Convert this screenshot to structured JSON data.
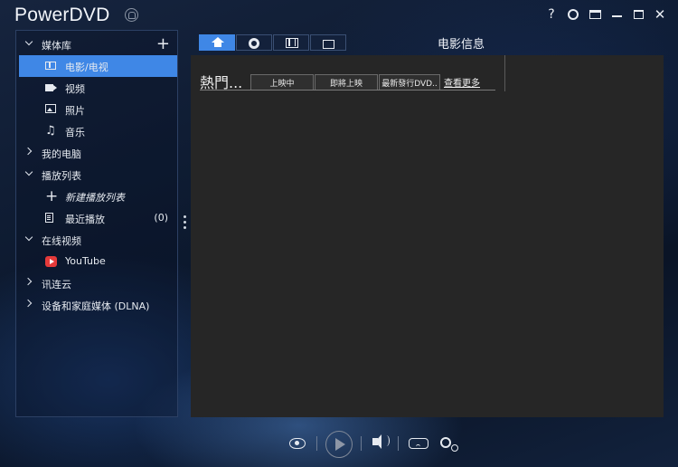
{
  "app": {
    "title": "PowerDVD"
  },
  "window": {
    "help_label": "?",
    "close_label": "✕"
  },
  "sidebar": {
    "items": [
      {
        "label": "媒体库",
        "type": "section",
        "expanded": true,
        "action": "+"
      },
      {
        "label": "电影/电视",
        "type": "sub",
        "icon": "film-icon",
        "selected": true
      },
      {
        "label": "视频",
        "type": "sub",
        "icon": "video-camera-icon"
      },
      {
        "label": "照片",
        "type": "sub",
        "icon": "photo-icon"
      },
      {
        "label": "音乐",
        "type": "sub",
        "icon": "music-icon"
      },
      {
        "label": "我的电脑",
        "type": "section",
        "expanded": false
      },
      {
        "label": "播放列表",
        "type": "section",
        "expanded": true
      },
      {
        "label": "新建播放列表",
        "type": "sub",
        "icon": "plus-icon",
        "italic": true
      },
      {
        "label": "最近播放",
        "type": "sub",
        "icon": "recent-icon",
        "count": "(0)"
      },
      {
        "label": "在线视频",
        "type": "section",
        "expanded": true
      },
      {
        "label": "YouTube",
        "type": "sub",
        "icon": "youtube-icon"
      },
      {
        "label": "讯连云",
        "type": "section",
        "expanded": false
      },
      {
        "label": "设备和家庭媒体 (DLNA)",
        "type": "section",
        "expanded": false
      }
    ]
  },
  "tabs": [
    {
      "icon": "home-icon",
      "active": true
    },
    {
      "icon": "disc-icon",
      "active": false
    },
    {
      "icon": "film-reel-icon",
      "active": false
    },
    {
      "icon": "tv-icon",
      "active": false
    }
  ],
  "main": {
    "section_title": "电影信息",
    "hot_label": "熱門...",
    "movie_tabs": [
      {
        "label": "上映中"
      },
      {
        "label": "即將上映"
      },
      {
        "label": "最新發行DVD.."
      }
    ],
    "see_more": "查看更多"
  },
  "colors": {
    "accent": "#3f87e6",
    "content_bg": "#262626",
    "youtube_red": "#e53a3a"
  }
}
